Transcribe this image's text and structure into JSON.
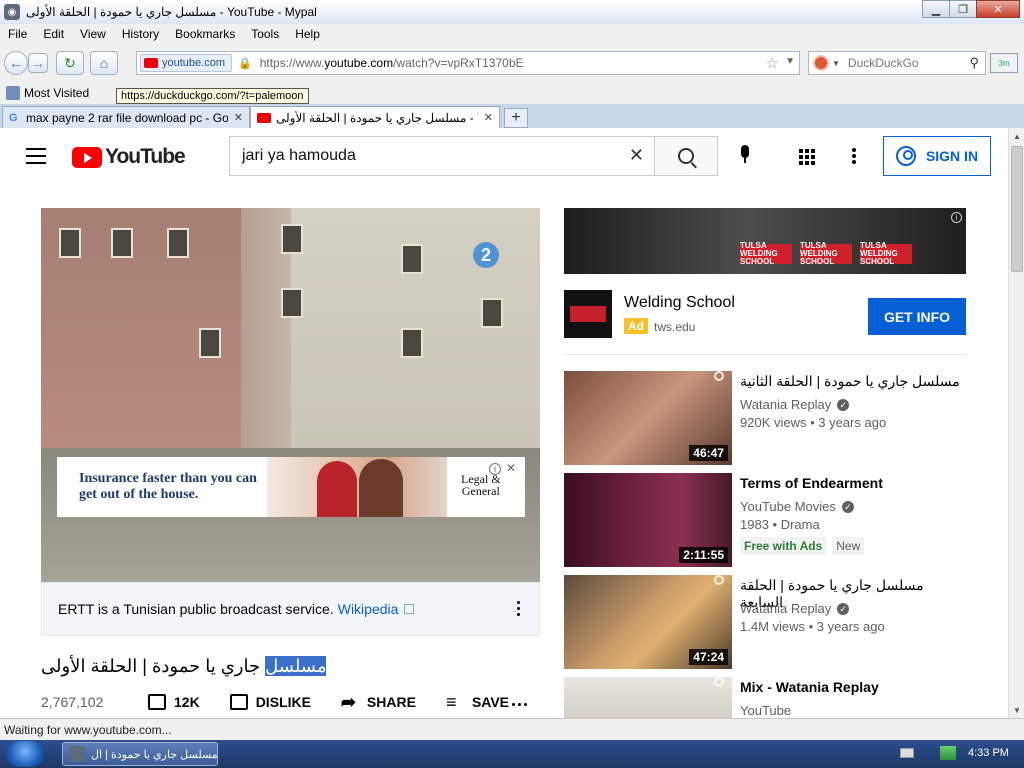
{
  "window": {
    "title": "مسلسل جاري يا حمودة | الحلقة الأولى - YouTube - Mypal"
  },
  "menubar": {
    "items": [
      {
        "label": "File"
      },
      {
        "label": "Edit"
      },
      {
        "label": "View"
      },
      {
        "label": "History"
      },
      {
        "label": "Bookmarks"
      },
      {
        "label": "Tools"
      },
      {
        "label": "Help"
      }
    ]
  },
  "navbar": {
    "site_identity": "youtube.com",
    "url_prefix": "https://www.",
    "url_domain": "youtube.com",
    "url_suffix": "/watch?v=vpRxT1370bE",
    "search_placeholder": "DuckDuckGo",
    "extra_label": "3m"
  },
  "bookmarks": {
    "most_visited": "Most Visited",
    "tooltip": "https://duckduckgo.com/?t=palemoon"
  },
  "tabs": [
    {
      "label": "max payne 2 rar file download pc - Go..."
    },
    {
      "label": "مسلسل جاري يا حمودة | الحلقة الأولى - YouTube"
    }
  ],
  "youtube": {
    "logo_text": "YouTube",
    "search_query": "jari ya hamouda",
    "signin_label": "SIGN IN"
  },
  "player": {
    "overlay_ad_text": "Insurance faster than you can get out of the house.",
    "overlay_ad_brand_1": "Legal &",
    "overlay_ad_brand_2": "General",
    "channel_badge": "2"
  },
  "info_panel": {
    "text": "ERTT is a Tunisian public broadcast service.",
    "link": "Wikipedia"
  },
  "video": {
    "title_highlight": "مسلسل",
    "title_rest": " جاري يا حمودة | الحلقة الأولى",
    "views": "2,767,102",
    "actions": [
      {
        "label": "12K"
      },
      {
        "label": "DISLIKE"
      },
      {
        "label": "SHARE"
      },
      {
        "label": "SAVE"
      }
    ]
  },
  "banner_ad": {
    "chip_text": "TULSA WELDING SCHOOL"
  },
  "ad_card": {
    "name": "Welding School",
    "badge": "Ad",
    "domain": "tws.edu",
    "cta": "GET INFO"
  },
  "recommendations": [
    {
      "title": "مسلسل جاري يا حمودة | الحلقة الثانية",
      "channel": "Watania Replay",
      "meta": "920K views • 3 years ago",
      "duration": "46:47",
      "arabic": true,
      "verified": true,
      "tags": []
    },
    {
      "title": "Terms of Endearment",
      "channel": "YouTube Movies",
      "meta": "1983 • Drama",
      "duration": "2:11:55",
      "arabic": false,
      "verified": true,
      "tags": [
        "Free with Ads",
        "New"
      ]
    },
    {
      "title": "مسلسل جاري يا حمودة | الحلقة السابعة",
      "channel": "Watania Replay",
      "meta": "1.4M views • 3 years ago",
      "duration": "47:24",
      "arabic": true,
      "verified": true,
      "tags": []
    },
    {
      "title": "Mix - Watania Replay",
      "channel": "YouTube",
      "meta": "",
      "duration": "",
      "arabic": false,
      "verified": false,
      "tags": []
    }
  ],
  "statusbar": {
    "text": "Waiting for www.youtube.com..."
  },
  "taskbar": {
    "task_label": "مسلسل جاري يا حمودة | ال...",
    "clock": "4:33 PM"
  },
  "colors": {
    "youtube_red": "#ff0000",
    "link_blue": "#065fd4",
    "highlight": "#3a70c9"
  }
}
